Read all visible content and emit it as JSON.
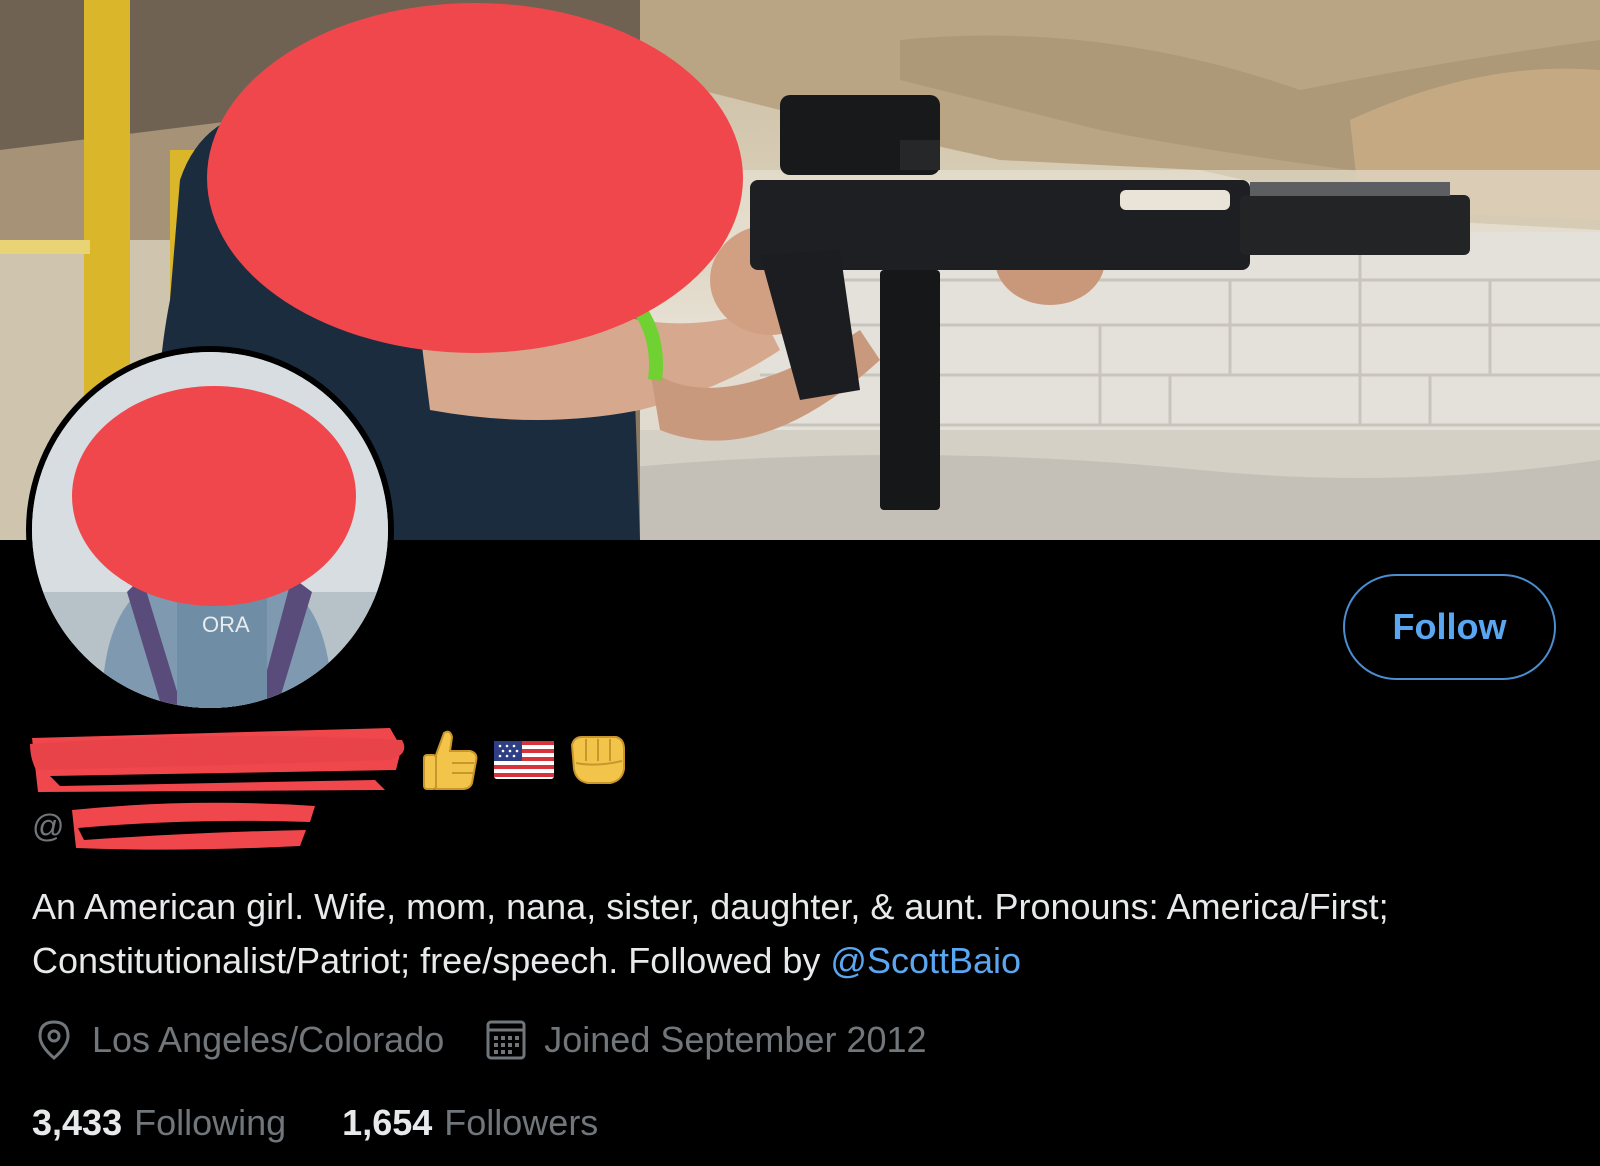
{
  "profile": {
    "handle_prefix": "@",
    "bio_text": "An American girl. Wife, mom, nana, sister, daughter, & aunt. Pronouns: America/First; Constitutionalist/Patriot; free/speech. Followed by ",
    "bio_mention": "@ScottBaio",
    "location": "Los Angeles/Colorado",
    "joined": "Joined September 2012",
    "emojis": [
      "thumbs-up-icon",
      "us-flag-icon",
      "fist-bump-icon"
    ]
  },
  "actions": {
    "follow_label": "Follow"
  },
  "stats": {
    "following_count": "3,433",
    "following_label": "Following",
    "followers_count": "1,654",
    "followers_label": "Followers"
  },
  "colors": {
    "background": "#000000",
    "accent": "#5aa6f0",
    "muted": "#71767b",
    "redaction": "#f0474c"
  }
}
